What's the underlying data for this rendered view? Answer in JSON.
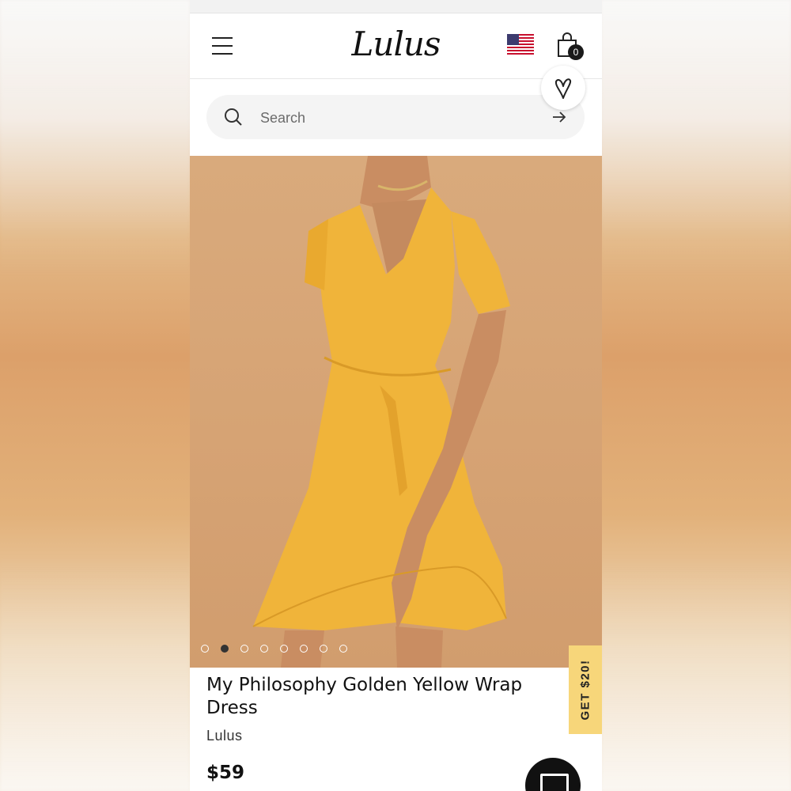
{
  "header": {
    "brand_logo": "Lulus",
    "cart_count": "0"
  },
  "search": {
    "placeholder": "Search"
  },
  "gallery": {
    "image_count": 8,
    "active_index": 1
  },
  "product": {
    "title": "My Philosophy Golden Yellow Wrap Dress",
    "brand": "Lulus",
    "price": "$59"
  },
  "promo": {
    "label": "GET $20!"
  },
  "colors": {
    "promo_bg": "#f7d67a",
    "dress": "#f0b43a",
    "backdrop": "#d8a677"
  }
}
